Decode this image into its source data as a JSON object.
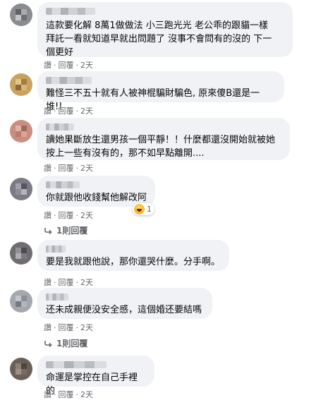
{
  "actions": {
    "like": "讚",
    "reply": "回覆",
    "sep": "·"
  },
  "comments": [
    {
      "text": "這款要化解 8萬1做做法 小三跑光光 老公乖的跟貓一樣\n拜託一看就知道早就出問題了 沒事不會問有的沒的 下一\n個更好",
      "time": "2天"
    },
    {
      "text": "難怪三不五十就有人被神棍騙財騙色, 原來傻B還是一堆!!",
      "time": "2天"
    },
    {
      "text": "讀她果斷放生還男孩一個平靜！！什麼都還沒開始就被她\n按上一些有沒有的，那不如早點離開....",
      "time": "2天"
    },
    {
      "text": "你就跟他收錢幫他解改阿",
      "time": "2天",
      "reaction_count": "1",
      "replies": "1則回覆"
    },
    {
      "text": "要是我就跟他說，那你還哭什麼。分手啊。",
      "time": "2天"
    },
    {
      "text": "还未成親便没安全感，這個婚还要結嗎",
      "time": "2天",
      "replies": "1則回覆"
    },
    {
      "text": "命運是掌控在自己手裡的",
      "time": "2天"
    }
  ]
}
